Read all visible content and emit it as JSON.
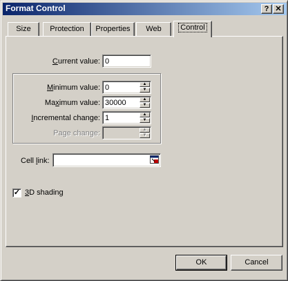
{
  "window": {
    "title": "Format Control",
    "help_glyph": "?",
    "close_glyph": "✕"
  },
  "tabs": [
    {
      "label": "Size"
    },
    {
      "label": "Protection"
    },
    {
      "label": "Properties"
    },
    {
      "label": "Web"
    },
    {
      "label": "Control",
      "active": true
    }
  ],
  "control": {
    "current_value_label": "Current value:",
    "current_value": "0",
    "min_label": "Minimum value:",
    "min_value": "0",
    "max_label": "Maximum value:",
    "max_value": "30000",
    "inc_label": "Incremental change:",
    "inc_value": "1",
    "page_label": "Page change:",
    "page_value": "",
    "cell_link_label": "Cell link:",
    "cell_link_value": "",
    "shading_label": "3D shading",
    "shading_checked": true
  },
  "buttons": {
    "ok": "OK",
    "cancel": "Cancel"
  },
  "colors": {
    "title_start": "#0a246a",
    "title_end": "#a6caf0",
    "face": "#d4d0c8"
  }
}
